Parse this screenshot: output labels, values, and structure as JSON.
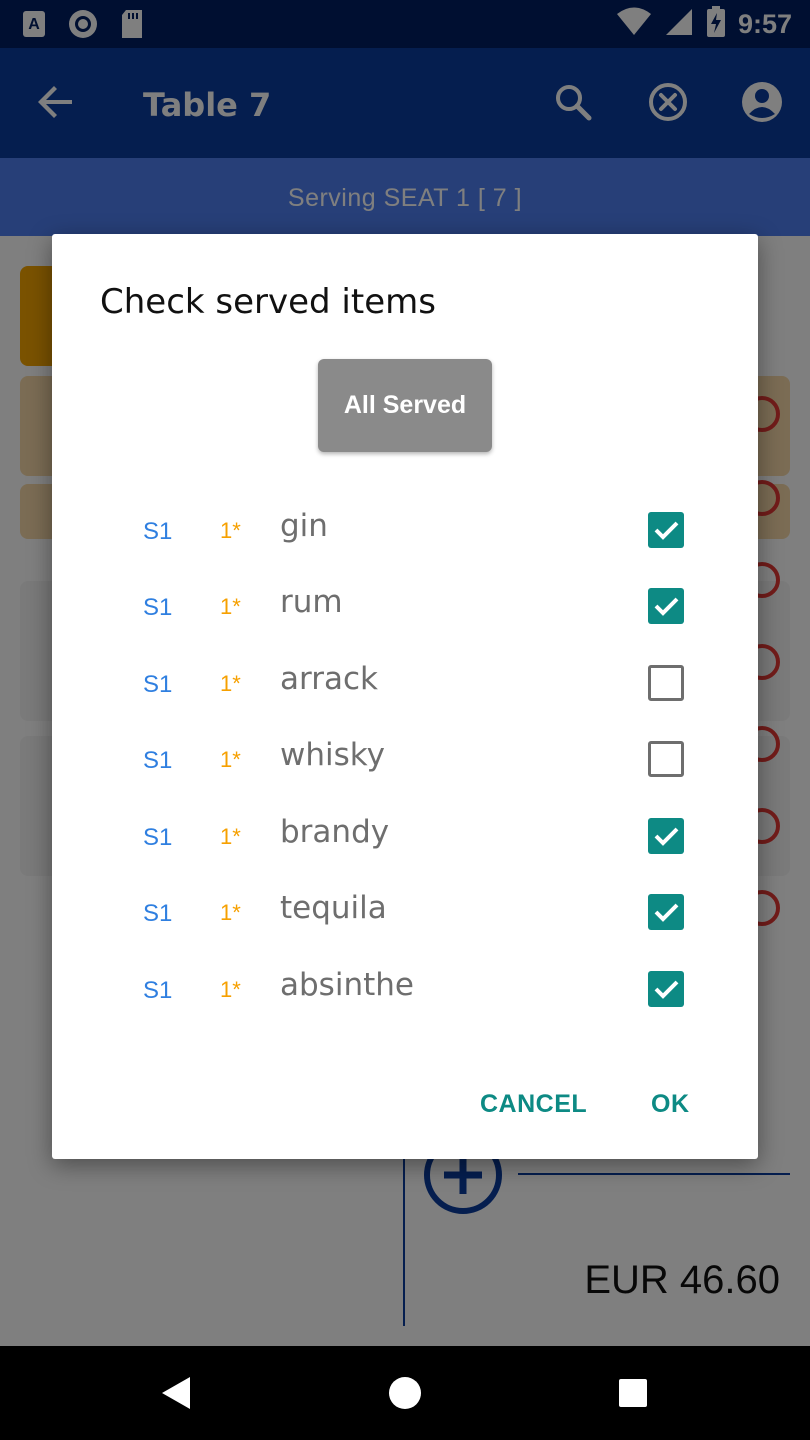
{
  "status_bar": {
    "time": "9:57",
    "icons": [
      "a-notification-icon",
      "record-icon",
      "sd-card-icon",
      "wifi-icon",
      "signal-icon",
      "battery-charging-icon"
    ]
  },
  "app_bar": {
    "title": "Table 7",
    "icons": [
      "back-arrow-icon",
      "search-icon",
      "clear-icon",
      "account-icon"
    ]
  },
  "serving": {
    "text": "Serving SEAT 1  [ 7 ]"
  },
  "background": {
    "total": "EUR 46.60"
  },
  "dialog": {
    "title": "Check served items",
    "all_served_label": "All Served",
    "items": [
      {
        "seat": "S1",
        "qty": "1*",
        "name": "gin",
        "served": true
      },
      {
        "seat": "S1",
        "qty": "1*",
        "name": "rum",
        "served": true
      },
      {
        "seat": "S1",
        "qty": "1*",
        "name": "arrack",
        "served": false
      },
      {
        "seat": "S1",
        "qty": "1*",
        "name": "whisky",
        "served": false
      },
      {
        "seat": "S1",
        "qty": "1*",
        "name": "brandy",
        "served": true
      },
      {
        "seat": "S1",
        "qty": "1*",
        "name": "tequila",
        "served": true
      },
      {
        "seat": "S1",
        "qty": "1*",
        "name": "absinthe",
        "served": true
      }
    ],
    "cancel_label": "CANCEL",
    "ok_label": "OK"
  },
  "nav_bar": {
    "icons": [
      "back-triangle-icon",
      "home-circle-icon",
      "recents-square-icon"
    ]
  },
  "colors": {
    "primary": "#0a3d9f",
    "status_bar": "#001f63",
    "accent": "#0d8a84",
    "seat_text": "#2f7fe0",
    "qty_text": "#f6a000"
  }
}
